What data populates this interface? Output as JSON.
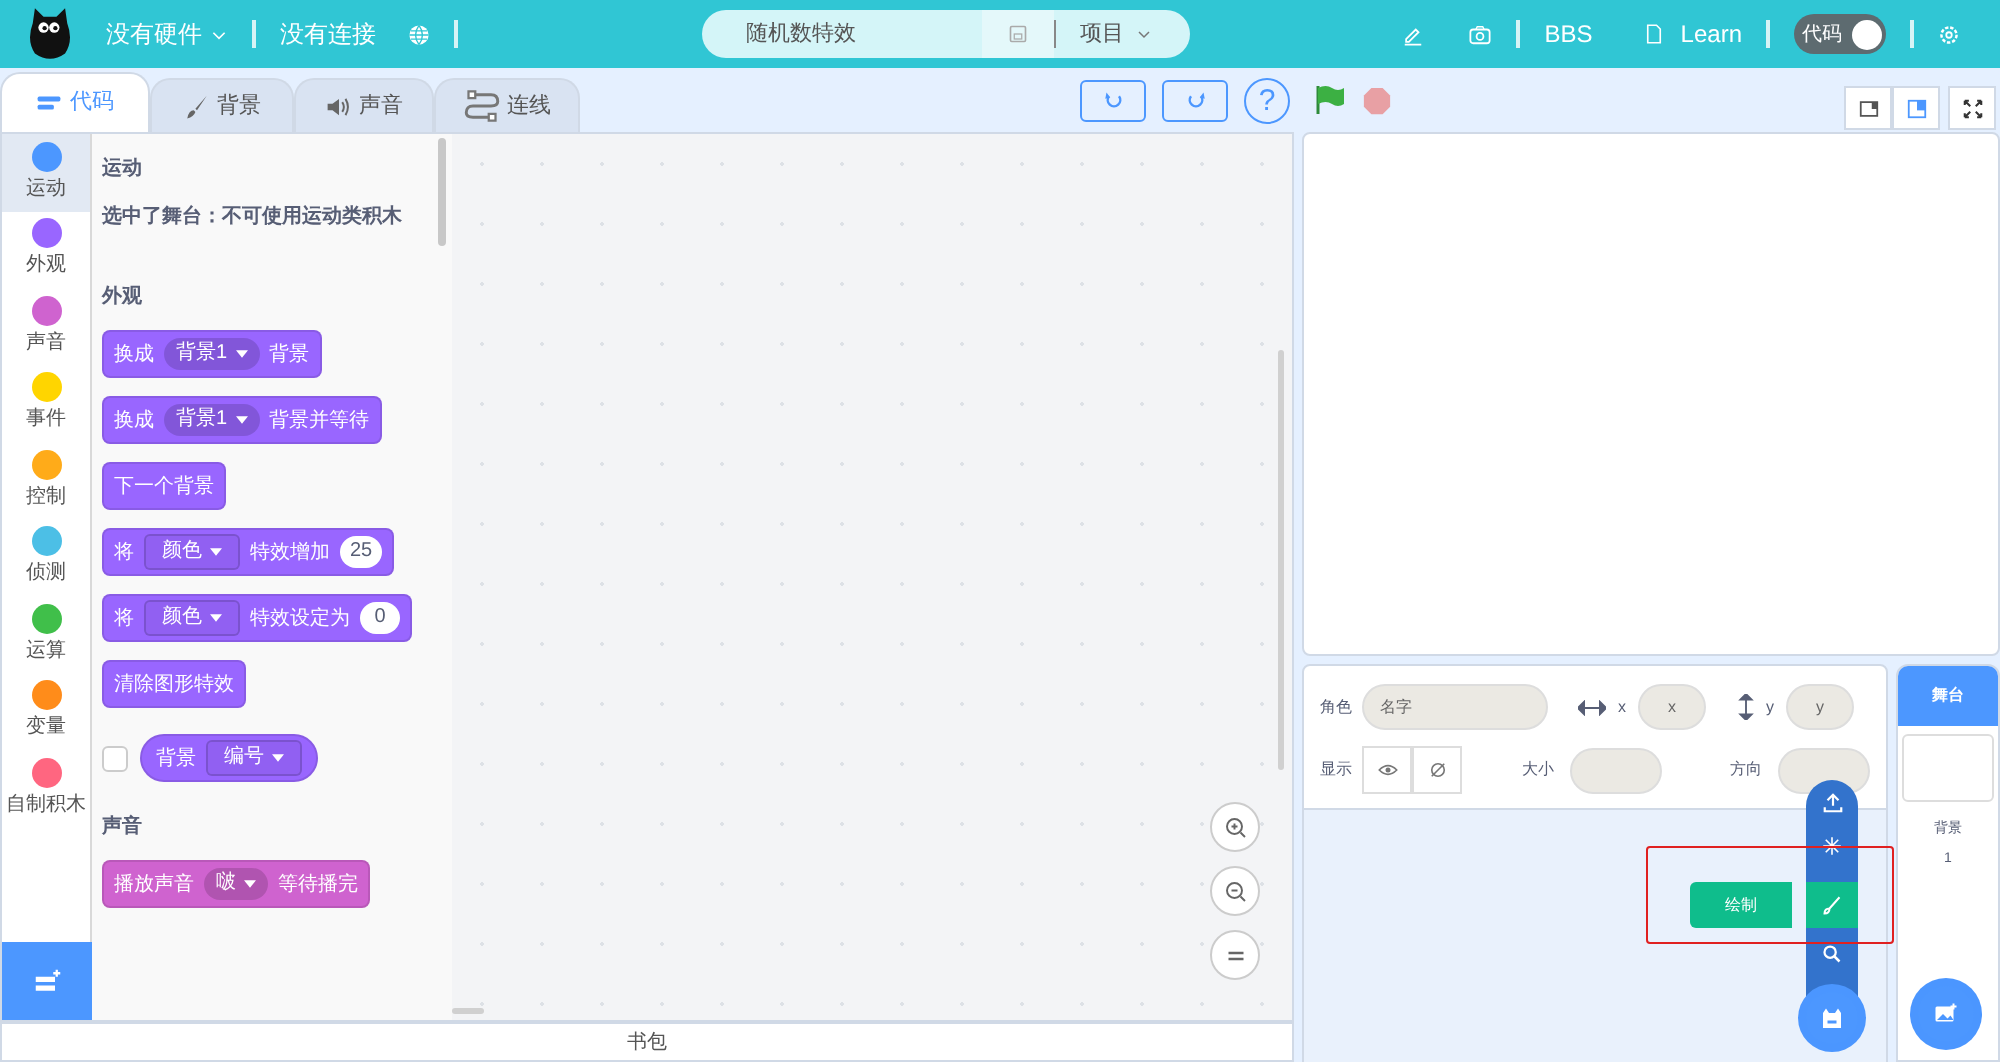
{
  "topbar": {
    "hardware": "没有硬件",
    "connection": "没有连接",
    "project_name": "随机数特效",
    "project_menu": "项目",
    "links": [
      "BBS",
      "Learn"
    ],
    "mode_toggle": {
      "label": "代码",
      "on": true
    }
  },
  "tabs": [
    {
      "label": "代码",
      "selected": true,
      "kind": "code"
    },
    {
      "label": "背景",
      "selected": false,
      "kind": "brush"
    },
    {
      "label": "声音",
      "selected": false,
      "kind": "sound"
    },
    {
      "label": "连线",
      "selected": false,
      "kind": "wire"
    }
  ],
  "toolbar": {
    "help": "?"
  },
  "categories": [
    {
      "label": "运动",
      "color": "#4c97ff",
      "selected": true
    },
    {
      "label": "外观",
      "color": "#9966ff",
      "selected": false
    },
    {
      "label": "声音",
      "color": "#cf63cf",
      "selected": false
    },
    {
      "label": "事件",
      "color": "#ffd500",
      "selected": false
    },
    {
      "label": "控制",
      "color": "#ffab19",
      "selected": false
    },
    {
      "label": "侦测",
      "color": "#4cbfe6",
      "selected": false
    },
    {
      "label": "运算",
      "color": "#40bf4a",
      "selected": false
    },
    {
      "label": "变量",
      "color": "#ff8c1a",
      "selected": false
    },
    {
      "label": "自制积木",
      "color": "#ff6680",
      "selected": false
    }
  ],
  "palette": [
    {
      "kind": "heading",
      "text": "运动"
    },
    {
      "kind": "note",
      "text": "选中了舞台：不可使用运动类积木"
    },
    {
      "kind": "heading",
      "text": "外观"
    },
    {
      "kind": "block",
      "color": "#9966ff",
      "parts": [
        {
          "kind": "text",
          "text": "换成"
        },
        {
          "kind": "dropdown",
          "text": "背景1"
        },
        {
          "kind": "text",
          "text": "背景"
        }
      ]
    },
    {
      "kind": "block",
      "color": "#9966ff",
      "parts": [
        {
          "kind": "text",
          "text": "换成"
        },
        {
          "kind": "dropdown",
          "text": "背景1"
        },
        {
          "kind": "text",
          "text": "背景并等待"
        }
      ]
    },
    {
      "kind": "block",
      "color": "#9966ff",
      "parts": [
        {
          "kind": "text",
          "text": "下一个背景"
        }
      ]
    },
    {
      "kind": "block",
      "color": "#9966ff",
      "parts": [
        {
          "kind": "text",
          "text": "将"
        },
        {
          "kind": "menu",
          "text": "颜色"
        },
        {
          "kind": "text",
          "text": "特效增加"
        },
        {
          "kind": "number",
          "text": "25"
        }
      ]
    },
    {
      "kind": "block",
      "color": "#9966ff",
      "parts": [
        {
          "kind": "text",
          "text": "将"
        },
        {
          "kind": "menu",
          "text": "颜色"
        },
        {
          "kind": "text",
          "text": "特效设定为"
        },
        {
          "kind": "number",
          "text": "0"
        }
      ]
    },
    {
      "kind": "block",
      "color": "#9966ff",
      "parts": [
        {
          "kind": "text",
          "text": "清除图形特效"
        }
      ]
    },
    {
      "kind": "reporter",
      "color": "#9966ff",
      "checked": false,
      "parts": [
        {
          "kind": "text",
          "text": "背景"
        },
        {
          "kind": "menu",
          "text": "编号"
        }
      ]
    },
    {
      "kind": "heading",
      "text": "声音"
    },
    {
      "kind": "block",
      "color": "#cf63cf",
      "parts": [
        {
          "kind": "text",
          "text": "播放声音"
        },
        {
          "kind": "dropdown",
          "text": "啵"
        },
        {
          "kind": "text",
          "text": "等待播完"
        }
      ]
    }
  ],
  "backpack": "书包",
  "sprite_info": {
    "sprite_label": "角色",
    "name_placeholder": "名字",
    "x_label": "x",
    "x_placeholder": "x",
    "y_label": "y",
    "y_placeholder": "y",
    "show_label": "显示",
    "size_label": "大小",
    "direction_label": "方向"
  },
  "sprite_menu": {
    "paint_label": "绘制"
  },
  "stage_panel": {
    "title": "舞台",
    "backdrops_label": "背景",
    "backdrops_count": "1"
  }
}
